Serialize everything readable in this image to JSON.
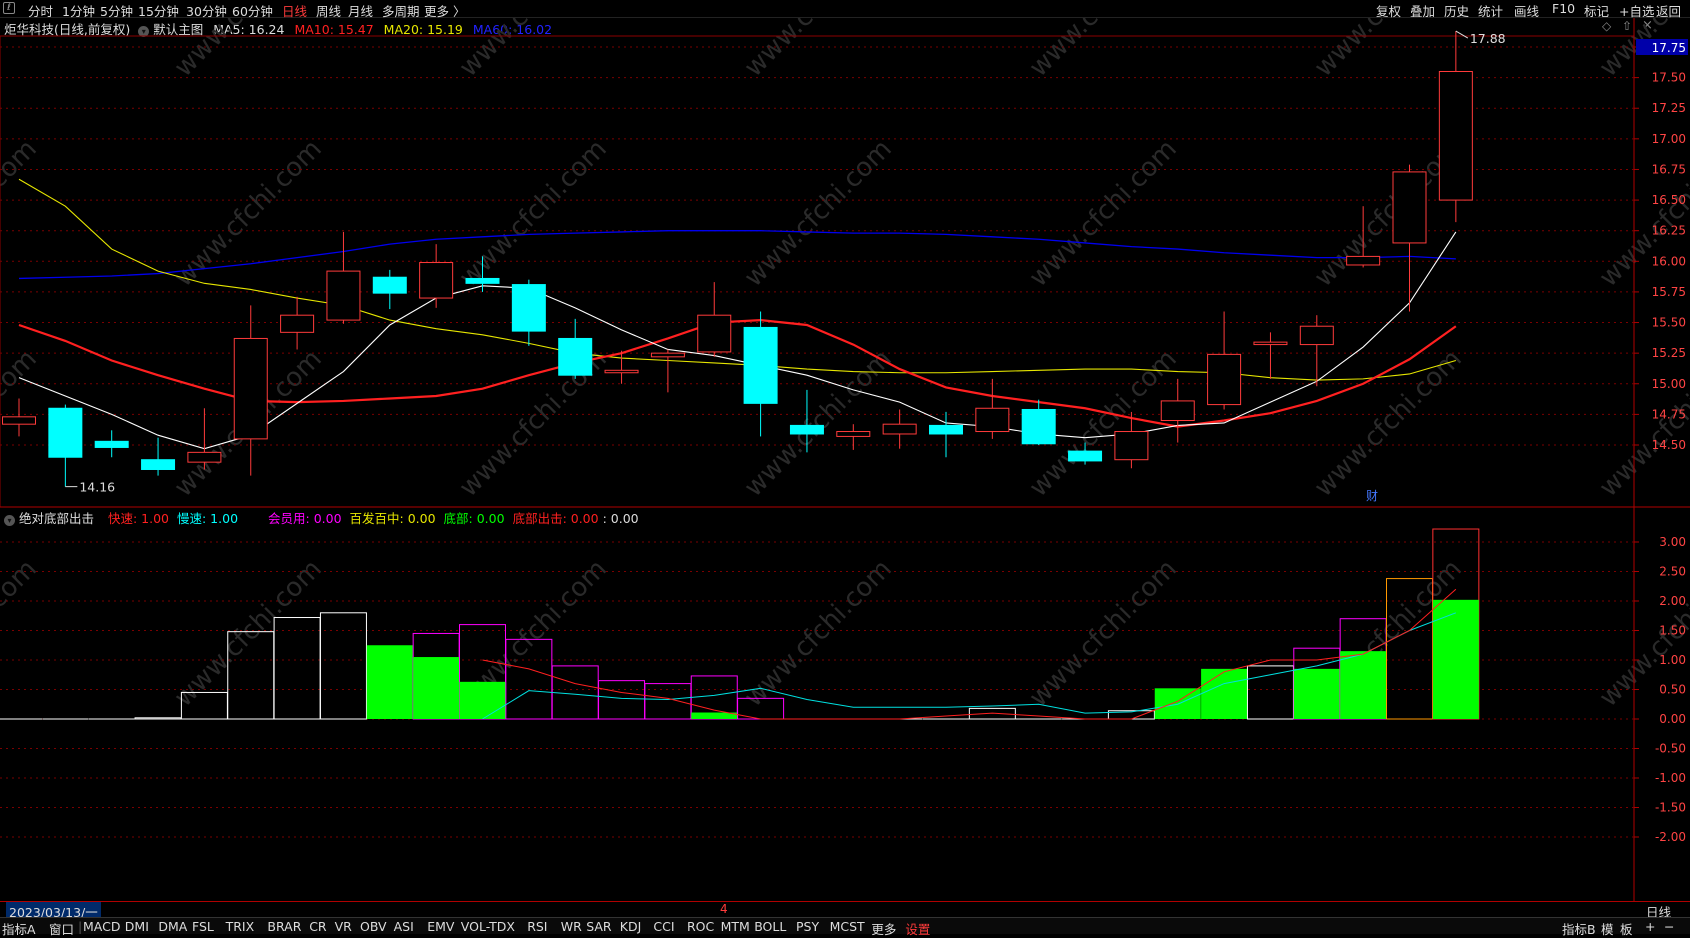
{
  "toolbar": {
    "left_items": [
      {
        "label": "分时"
      },
      {
        "label": "1分钟"
      },
      {
        "label": "5分钟"
      },
      {
        "label": "15分钟"
      },
      {
        "label": "30分钟"
      },
      {
        "label": "60分钟"
      },
      {
        "label": "日线",
        "active": true
      },
      {
        "label": "周线"
      },
      {
        "label": "月线"
      },
      {
        "label": "多周期"
      },
      {
        "label": "更多 〉"
      }
    ],
    "right_items": [
      {
        "label": "复权"
      },
      {
        "label": "叠加"
      },
      {
        "label": "历史"
      },
      {
        "label": "统计"
      },
      {
        "label": "画线"
      },
      {
        "label": "F10"
      },
      {
        "label": "标记"
      },
      {
        "label": "+自选"
      },
      {
        "label": "返回"
      }
    ]
  },
  "main_info": {
    "stock_title": "炬华科技(日线,前复权)",
    "chart_name": "默认主图",
    "ma5": "MA5: 16.24",
    "ma10": "MA10: 15.47",
    "ma20": "MA20: 15.19",
    "ma60": "MA60: 16.02"
  },
  "price_axis": {
    "ticks": [
      "17.75",
      "17.50",
      "17.25",
      "17.00",
      "16.75",
      "16.50",
      "16.25",
      "16.00",
      "15.75",
      "15.50",
      "15.25",
      "15.00",
      "14.75",
      "14.50"
    ],
    "current_price": "17.75"
  },
  "annotations": {
    "high_label": "17.88",
    "low_label": "14.16",
    "finance_marker": "财"
  },
  "indicator_info": {
    "name": "绝对底部出击",
    "fast": "快速: 1.00",
    "slow": "慢速: 1.00",
    "member": "会员用: 0.00",
    "hit": "百发百中: 0.00",
    "bottom": "底部: 0.00",
    "bottom_out": "底部出击: 0.00",
    "last": ": 0.00"
  },
  "indicator_axis": {
    "ticks": [
      "3.00",
      "2.50",
      "2.00",
      "1.50",
      "1.00",
      "0.50",
      "0.00",
      "-0.50",
      "-1.00",
      "-1.50",
      "-2.00"
    ]
  },
  "datebar": {
    "date": "2023/03/13/一",
    "marker": "4",
    "period": "日线"
  },
  "tabs": {
    "left": [
      "指标A",
      "窗口",
      "MACD",
      "DMI",
      "DMA",
      "FSL",
      "TRIX",
      "BRAR",
      "CR",
      "VR",
      "OBV",
      "ASI",
      "EMV",
      "VOL-TDX",
      "RSI",
      "WR",
      "SAR",
      "KDJ",
      "CCI",
      "ROC",
      "MTM",
      "BOLL",
      "PSY",
      "MCST",
      "更多",
      "设置"
    ],
    "right": [
      "指标B",
      "模",
      "板",
      "+",
      "−"
    ]
  },
  "watermark": "www.cfchi.com",
  "colors": {
    "up": "#ff3b3b",
    "down": "#00ffff",
    "ma5": "#ffffff",
    "ma10": "#ff2020",
    "ma20": "#e6e600",
    "ma60": "#0000ee",
    "bar_green": "#00ff00",
    "bar_white": "#ffffff",
    "bar_magenta": "#ff00ff",
    "bar_orange": "#ff9900",
    "grid": "#7a0000"
  },
  "chart_data": {
    "type": "candlestick",
    "candles": [
      {
        "o": 14.67,
        "h": 14.88,
        "l": 14.57,
        "c": 14.73
      },
      {
        "o": 14.8,
        "h": 14.83,
        "l": 14.16,
        "c": 14.4
      },
      {
        "o": 14.53,
        "h": 14.62,
        "l": 14.4,
        "c": 14.48
      },
      {
        "o": 14.38,
        "h": 14.56,
        "l": 14.25,
        "c": 14.3
      },
      {
        "o": 14.36,
        "h": 14.8,
        "l": 14.3,
        "c": 14.44
      },
      {
        "o": 14.55,
        "h": 15.64,
        "l": 14.25,
        "c": 15.37
      },
      {
        "o": 15.42,
        "h": 15.71,
        "l": 15.28,
        "c": 15.56
      },
      {
        "o": 15.52,
        "h": 16.24,
        "l": 15.49,
        "c": 15.92
      },
      {
        "o": 15.87,
        "h": 15.93,
        "l": 15.61,
        "c": 15.74
      },
      {
        "o": 15.7,
        "h": 16.14,
        "l": 15.62,
        "c": 15.99
      },
      {
        "o": 15.86,
        "h": 16.04,
        "l": 15.75,
        "c": 15.82
      },
      {
        "o": 15.81,
        "h": 15.85,
        "l": 15.31,
        "c": 15.43
      },
      {
        "o": 15.37,
        "h": 15.53,
        "l": 15.04,
        "c": 15.07
      },
      {
        "o": 15.09,
        "h": 15.27,
        "l": 15.0,
        "c": 15.11
      },
      {
        "o": 15.22,
        "h": 15.28,
        "l": 14.93,
        "c": 15.25
      },
      {
        "o": 15.26,
        "h": 15.83,
        "l": 15.22,
        "c": 15.56
      },
      {
        "o": 15.46,
        "h": 15.59,
        "l": 14.57,
        "c": 14.84
      },
      {
        "o": 14.66,
        "h": 14.95,
        "l": 14.44,
        "c": 14.59
      },
      {
        "o": 14.57,
        "h": 14.67,
        "l": 14.46,
        "c": 14.61
      },
      {
        "o": 14.59,
        "h": 14.79,
        "l": 14.47,
        "c": 14.67
      },
      {
        "o": 14.66,
        "h": 14.77,
        "l": 14.4,
        "c": 14.59
      },
      {
        "o": 14.61,
        "h": 15.04,
        "l": 14.55,
        "c": 14.8
      },
      {
        "o": 14.79,
        "h": 14.87,
        "l": 14.5,
        "c": 14.51
      },
      {
        "o": 14.45,
        "h": 14.52,
        "l": 14.34,
        "c": 14.37
      },
      {
        "o": 14.38,
        "h": 14.77,
        "l": 14.31,
        "c": 14.61
      },
      {
        "o": 14.7,
        "h": 15.04,
        "l": 14.52,
        "c": 14.86
      },
      {
        "o": 14.83,
        "h": 15.59,
        "l": 14.79,
        "c": 15.24
      },
      {
        "o": 15.32,
        "h": 15.42,
        "l": 15.04,
        "c": 15.34
      },
      {
        "o": 15.32,
        "h": 15.56,
        "l": 14.98,
        "c": 15.47
      },
      {
        "o": 15.97,
        "h": 16.45,
        "l": 15.95,
        "c": 16.04
      },
      {
        "o": 16.15,
        "h": 16.79,
        "l": 15.59,
        "c": 16.73
      },
      {
        "o": 16.5,
        "h": 17.88,
        "l": 16.32,
        "c": 17.55
      }
    ],
    "ma5": [
      15.05,
      14.9,
      14.75,
      14.58,
      14.47,
      14.58,
      14.84,
      15.1,
      15.48,
      15.7,
      15.8,
      15.78,
      15.62,
      15.44,
      15.28,
      15.23,
      15.15,
      15.07,
      14.95,
      14.85,
      14.68,
      14.65,
      14.59,
      14.56,
      14.59,
      14.66,
      14.68,
      14.85,
      15.02,
      15.3,
      15.66,
      16.24
    ],
    "ma10": [
      15.48,
      15.35,
      15.19,
      15.07,
      14.96,
      14.86,
      14.85,
      14.86,
      14.88,
      14.9,
      14.96,
      15.07,
      15.17,
      15.25,
      15.37,
      15.5,
      15.52,
      15.48,
      15.32,
      15.12,
      14.97,
      14.9,
      14.85,
      14.8,
      14.72,
      14.65,
      14.7,
      14.76,
      14.86,
      15.0,
      15.2,
      15.47
    ],
    "ma20": [
      16.67,
      16.45,
      16.1,
      15.92,
      15.82,
      15.77,
      15.7,
      15.64,
      15.52,
      15.45,
      15.4,
      15.33,
      15.25,
      15.21,
      15.19,
      15.17,
      15.15,
      15.12,
      15.1,
      15.09,
      15.09,
      15.1,
      15.11,
      15.12,
      15.12,
      15.1,
      15.09,
      15.05,
      15.03,
      15.04,
      15.08,
      15.19
    ],
    "ma60": [
      15.86,
      15.87,
      15.88,
      15.9,
      15.94,
      15.98,
      16.03,
      16.08,
      16.14,
      16.18,
      16.2,
      16.22,
      16.23,
      16.24,
      16.25,
      16.25,
      16.25,
      16.24,
      16.23,
      16.23,
      16.22,
      16.2,
      16.18,
      16.15,
      16.12,
      16.1,
      16.07,
      16.05,
      16.03,
      16.03,
      16.04,
      16.02
    ],
    "indicator_bars": [
      {
        "v": 0.0,
        "c": "white"
      },
      {
        "v": 0.0,
        "c": "white"
      },
      {
        "v": 0.0,
        "c": "white"
      },
      {
        "v": 0.02,
        "c": "white"
      },
      {
        "v": 0.45,
        "c": "white"
      },
      {
        "v": 1.48,
        "c": "white"
      },
      {
        "v": 1.72,
        "c": "white"
      },
      {
        "v": 1.8,
        "c": "white"
      },
      {
        "v": 1.25,
        "c": "green"
      },
      {
        "v": 1.45,
        "c": "magenta",
        "inner": 1.05
      },
      {
        "v": 1.6,
        "c": "magenta",
        "inner": 0.63
      },
      {
        "v": 1.35,
        "c": "magenta"
      },
      {
        "v": 0.9,
        "c": "magenta"
      },
      {
        "v": 0.65,
        "c": "magenta"
      },
      {
        "v": 0.6,
        "c": "magenta"
      },
      {
        "v": 0.73,
        "c": "magenta",
        "inner": 0.11
      },
      {
        "v": 0.35,
        "c": "magenta"
      },
      {
        "v": 0.0,
        "c": "white"
      },
      {
        "v": 0.0,
        "c": "white"
      },
      {
        "v": 0.0,
        "c": "white"
      },
      {
        "v": 0.0,
        "c": "white"
      },
      {
        "v": 0.18,
        "c": "white"
      },
      {
        "v": 0.0,
        "c": "white"
      },
      {
        "v": 0.0,
        "c": "white"
      },
      {
        "v": 0.14,
        "c": "white"
      },
      {
        "v": 0.52,
        "c": "green"
      },
      {
        "v": 0.85,
        "c": "green"
      },
      {
        "v": 0.9,
        "c": "white"
      },
      {
        "v": 1.2,
        "c": "magenta",
        "inner": 0.85
      },
      {
        "v": 1.7,
        "c": "magenta",
        "inner": 1.15
      },
      {
        "v": 2.38,
        "c": "orange"
      },
      {
        "v": 3.22,
        "c": "red",
        "inner": 2.02
      }
    ],
    "indicator_line_cyan": [
      0,
      0,
      0,
      0,
      0,
      0,
      0,
      0,
      0,
      0,
      0,
      0.48,
      0.42,
      0.35,
      0.33,
      0.4,
      0.52,
      0.33,
      0.2,
      0.2,
      0.2,
      0.22,
      0.25,
      0.1,
      0.12,
      0.25,
      0.6,
      0.75,
      0.9,
      1.1,
      1.5,
      1.8
    ],
    "indicator_line_red": [
      0,
      0,
      0,
      0,
      0,
      0,
      0,
      0,
      0,
      0,
      1.0,
      0.85,
      0.6,
      0.45,
      0.35,
      0.15,
      0,
      0,
      0,
      0,
      0.05,
      0.1,
      0.05,
      0,
      0,
      0.3,
      0.8,
      1.0,
      1.0,
      1.1,
      1.5,
      2.2
    ],
    "y_range_price": [
      14.0,
      17.95
    ],
    "y_range_indicator": [
      -2.5,
      3.4
    ]
  }
}
